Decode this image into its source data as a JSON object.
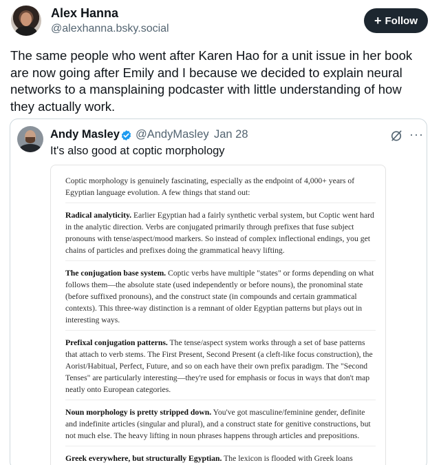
{
  "post": {
    "author_name": "Alex Hanna",
    "author_handle": "@alexhanna.bsky.social",
    "follow_label": "Follow",
    "follow_icon": "plus-icon",
    "text": "The same people who went after Karen Hao for a unit issue in her book are now going after Emily and I because we decided to explain neural networks to a mansplaining podcaster with little understanding of how they actually work."
  },
  "quote": {
    "author_name": "Andy Masley",
    "verified_icon": "verified-badge-icon",
    "author_handle": "@AndyMasley",
    "separator": "·",
    "date": "Jan 28",
    "text": "It's also good at coptic morphology",
    "action_icons": [
      "grok-icon",
      "more-icon"
    ],
    "more_label": "···",
    "image": {
      "intro": "Coptic morphology is genuinely fascinating, especially as the endpoint of 4,000+ years of Egyptian language evolution. A few things that stand out:",
      "sections": [
        {
          "heading": "Radical analyticity.",
          "body": " Earlier Egyptian had a fairly synthetic verbal system, but Coptic went hard in the analytic direction. Verbs are conjugated primarily through prefixes that fuse subject pronouns with tense/aspect/mood markers. So instead of complex inflectional endings, you get chains of particles and prefixes doing the grammatical heavy lifting."
        },
        {
          "heading": "The conjugation base system.",
          "body": " Coptic verbs have multiple \"states\" or forms depending on what follows them—the absolute state (used independently or before nouns), the pronominal state (before suffixed pronouns), and the construct state (in compounds and certain grammatical contexts). This three-way distinction is a remnant of older Egyptian patterns but plays out in interesting ways."
        },
        {
          "heading": "Prefixal conjugation patterns.",
          "body": " The tense/aspect system works through a set of base patterns that attach to verb stems. The First Present, Second Present (a cleft-like focus construction), the Aorist/Habitual, Perfect, Future, and so on each have their own prefix paradigm. The \"Second Tenses\" are particularly interesting—they're used for emphasis or focus in ways that don't map neatly onto European categories."
        },
        {
          "heading": "Noun morphology is pretty stripped down.",
          "body": " You've got masculine/feminine gender, definite and indefinite articles (singular and plural), and a construct state for genitive constructions, but not much else. The heavy lifting in noun phrases happens through articles and prepositions."
        },
        {
          "heading": "Greek everywhere, but structurally Egyptian.",
          "body": " The lexicon is flooded with Greek loans (especially in religious and abstract vocabulary), but the underlying grammatical architecture stayed Egyptian."
        }
      ]
    }
  },
  "colors": {
    "text_primary": "#0f1419",
    "text_secondary": "#536471",
    "follow_bg": "#1d2730",
    "verified_blue": "#1d9bf0",
    "card_border": "#cfd9de"
  }
}
